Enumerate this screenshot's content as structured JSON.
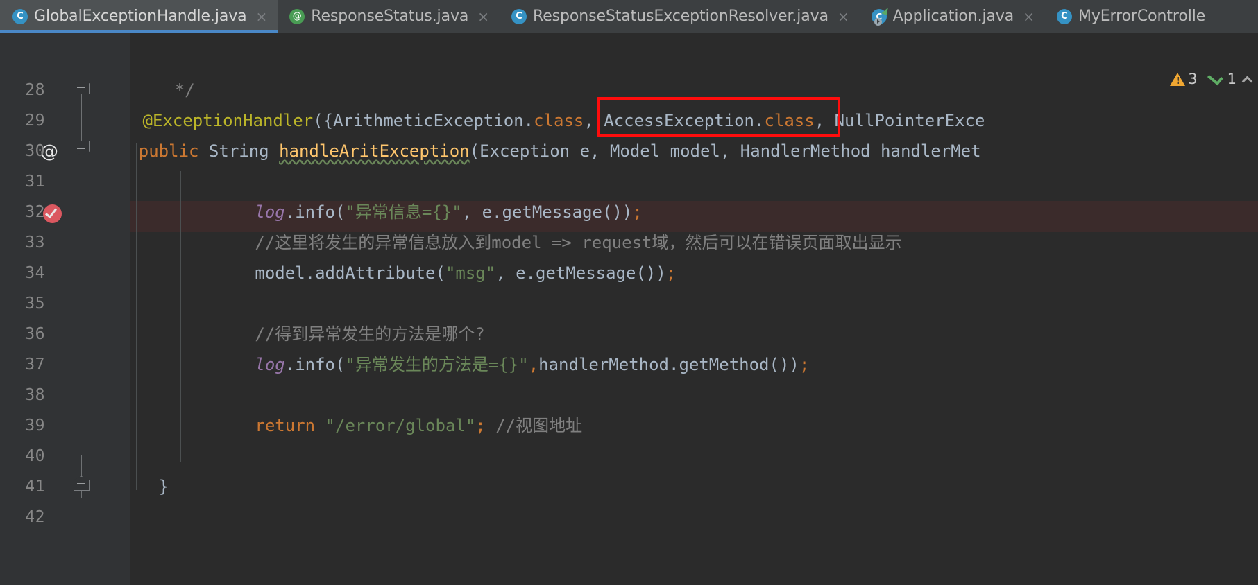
{
  "window": {
    "theme_bg": "#2b2b2b",
    "gutter_bg": "#313335",
    "accent": "#4a88c7"
  },
  "tabs": [
    {
      "label": "GlobalExceptionHandle.java",
      "icon": "java-class-icon",
      "icon_glyph": "C",
      "icon_kind": "class",
      "active": true,
      "close_glyph": "×"
    },
    {
      "label": "ResponseStatus.java",
      "icon": "java-annotation-icon",
      "icon_glyph": "@",
      "icon_kind": "annotation",
      "active": false,
      "close_glyph": "×"
    },
    {
      "label": "ResponseStatusExceptionResolver.java",
      "icon": "java-class-icon",
      "icon_glyph": "C",
      "icon_kind": "class",
      "active": false,
      "close_glyph": "×"
    },
    {
      "label": "Application.java",
      "icon": "spring-boot-run-icon",
      "icon_glyph": "C",
      "icon_kind": "spring",
      "active": false,
      "close_glyph": "×"
    },
    {
      "label": "MyErrorControlle",
      "icon": "java-class-icon",
      "icon_glyph": "C",
      "icon_kind": "class",
      "active": false,
      "close_glyph": ""
    }
  ],
  "inspection": {
    "warning_icon": "warning-triangle-icon",
    "warning_count": "3",
    "ok_icon": "green-check-icon",
    "ok_count": "1",
    "collapse_icon": "chevron-up-icon"
  },
  "gutter": {
    "line_numbers": [
      "28",
      "29",
      "30",
      "31",
      "32",
      "33",
      "34",
      "35",
      "36",
      "37",
      "38",
      "39",
      "40",
      "41",
      "42"
    ],
    "annotation_marker": "@",
    "breakpoint_marker": "breakpoint-verified"
  },
  "code": {
    "lines": [
      {
        "n": "28",
        "tokens": [
          {
            "t": "*/",
            "c": "s-comment"
          }
        ]
      },
      {
        "n": "29",
        "tokens": [
          {
            "t": "@ExceptionHandler",
            "c": "s-annot"
          },
          {
            "t": "({",
            "c": "s-plain"
          },
          {
            "t": "ArithmeticException",
            "c": "s-type"
          },
          {
            "t": ".",
            "c": "s-plain"
          },
          {
            "t": "class",
            "c": "s-kw"
          },
          {
            "t": ", ",
            "c": "s-plain"
          },
          {
            "t": "AccessException",
            "c": "s-type"
          },
          {
            "t": ".",
            "c": "s-plain"
          },
          {
            "t": "class",
            "c": "s-kw"
          },
          {
            "t": ", ",
            "c": "s-plain"
          },
          {
            "t": "NullPointerExce",
            "c": "s-type"
          }
        ]
      },
      {
        "n": "30",
        "tokens": [
          {
            "t": "public",
            "c": "s-kw"
          },
          {
            "t": " ",
            "c": "s-plain"
          },
          {
            "t": "String",
            "c": "s-type"
          },
          {
            "t": " ",
            "c": "s-plain"
          },
          {
            "t": "handleAritException",
            "c": "s-method squiggle"
          },
          {
            "t": "(",
            "c": "s-plain"
          },
          {
            "t": "Exception",
            "c": "s-type"
          },
          {
            "t": " e, ",
            "c": "s-plain"
          },
          {
            "t": "Model",
            "c": "s-type"
          },
          {
            "t": " model, ",
            "c": "s-plain"
          },
          {
            "t": "HandlerMethod",
            "c": "s-type"
          },
          {
            "t": " handlerMet",
            "c": "s-plain"
          }
        ]
      },
      {
        "n": "31",
        "tokens": []
      },
      {
        "n": "32",
        "tokens": [
          {
            "t": "log",
            "c": "s-field"
          },
          {
            "t": ".info(",
            "c": "s-plain"
          },
          {
            "t": "\"异常信息={}\"",
            "c": "s-string"
          },
          {
            "t": ", e.getMessage())",
            "c": "s-plain"
          },
          {
            "t": ";",
            "c": "s-kw"
          }
        ]
      },
      {
        "n": "33",
        "tokens": [
          {
            "t": "//这里将发生的异常信息放入到model => request域，然后可以在错误页面取出显示",
            "c": "s-comment"
          }
        ]
      },
      {
        "n": "34",
        "tokens": [
          {
            "t": "model.addAttribute(",
            "c": "s-plain"
          },
          {
            "t": "\"msg\"",
            "c": "s-string"
          },
          {
            "t": ", e.getMessage())",
            "c": "s-plain"
          },
          {
            "t": ";",
            "c": "s-kw"
          }
        ]
      },
      {
        "n": "35",
        "tokens": []
      },
      {
        "n": "36",
        "tokens": [
          {
            "t": "//得到异常发生的方法是哪个?",
            "c": "s-comment"
          }
        ]
      },
      {
        "n": "37",
        "tokens": [
          {
            "t": "log",
            "c": "s-field"
          },
          {
            "t": ".info(",
            "c": "s-plain"
          },
          {
            "t": "\"异常发生的方法是={}\"",
            "c": "s-string"
          },
          {
            "t": ",",
            "c": "s-kw"
          },
          {
            "t": "handlerMethod.getMethod())",
            "c": "s-plain"
          },
          {
            "t": ";",
            "c": "s-kw"
          }
        ]
      },
      {
        "n": "38",
        "tokens": []
      },
      {
        "n": "39",
        "tokens": [
          {
            "t": "return",
            "c": "s-kw"
          },
          {
            "t": " ",
            "c": "s-plain"
          },
          {
            "t": "\"/error/global\"",
            "c": "s-string"
          },
          {
            "t": ";",
            "c": "s-kw"
          },
          {
            "t": " ",
            "c": "s-plain"
          },
          {
            "t": "//视图地址",
            "c": "s-comment"
          }
        ]
      },
      {
        "n": "40",
        "tokens": []
      },
      {
        "n": "41",
        "tokens": [
          {
            "t": "}",
            "c": "s-plain"
          }
        ]
      },
      {
        "n": "42",
        "tokens": []
      }
    ]
  },
  "annotation": {
    "red_box_target": "AccessException.class,"
  }
}
